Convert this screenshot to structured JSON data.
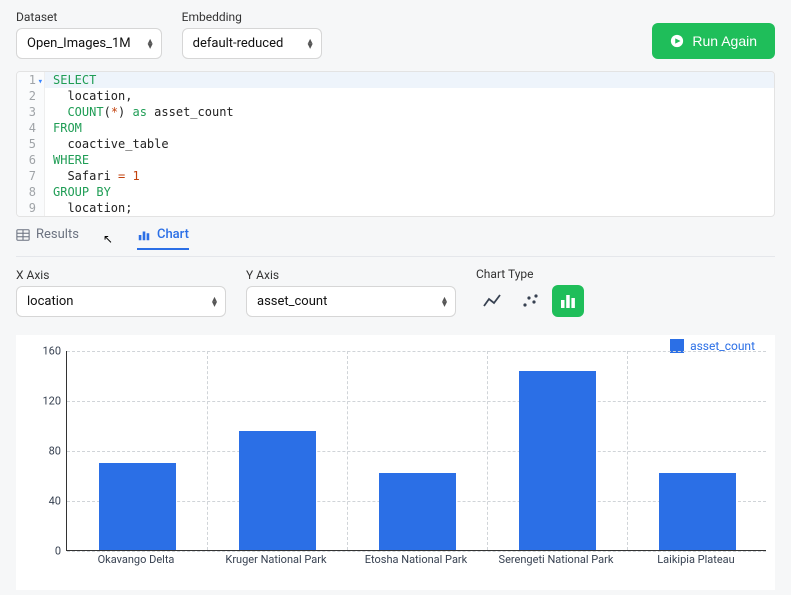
{
  "header": {
    "dataset_label": "Dataset",
    "dataset_value": "Open_Images_1M",
    "embedding_label": "Embedding",
    "embedding_value": "default-reduced",
    "run_label": "Run Again"
  },
  "code": {
    "lines": [
      {
        "n": "1",
        "tokens": [
          [
            "kw",
            "SELECT"
          ]
        ]
      },
      {
        "n": "2",
        "tokens": [
          [
            "id",
            "  location,"
          ]
        ]
      },
      {
        "n": "3",
        "tokens": [
          [
            "kw",
            "  COUNT"
          ],
          [
            "id",
            "("
          ],
          [
            "op",
            "*"
          ],
          [
            "id",
            ") "
          ],
          [
            "kw",
            "as"
          ],
          [
            "id",
            " asset_count"
          ]
        ]
      },
      {
        "n": "4",
        "tokens": [
          [
            "kw",
            "FROM"
          ]
        ]
      },
      {
        "n": "5",
        "tokens": [
          [
            "id",
            "  coactive_table"
          ]
        ]
      },
      {
        "n": "6",
        "tokens": [
          [
            "kw",
            "WHERE"
          ]
        ]
      },
      {
        "n": "7",
        "tokens": [
          [
            "id",
            "  Safari "
          ],
          [
            "op",
            "="
          ],
          [
            "id",
            " "
          ],
          [
            "num",
            "1"
          ]
        ]
      },
      {
        "n": "8",
        "tokens": [
          [
            "kw",
            "GROUP BY"
          ]
        ]
      },
      {
        "n": "9",
        "tokens": [
          [
            "id",
            "  location;"
          ]
        ]
      }
    ]
  },
  "tabs": {
    "results_label": "Results",
    "chart_label": "Chart"
  },
  "controls": {
    "xaxis_label": "X Axis",
    "xaxis_value": "location",
    "yaxis_label": "Y Axis",
    "yaxis_value": "asset_count",
    "charttype_label": "Chart Type"
  },
  "chart_data": {
    "type": "bar",
    "title": "",
    "xlabel": "",
    "ylabel": "",
    "ylim": [
      0,
      160
    ],
    "yticks": [
      0,
      40,
      80,
      120,
      160
    ],
    "legend": "asset_count",
    "categories": [
      "Okavango Delta",
      "Kruger National Park",
      "Etosha National Park",
      "Serengeti National Park",
      "Laikipia Plateau"
    ],
    "values": [
      70,
      95,
      62,
      143,
      62
    ]
  }
}
